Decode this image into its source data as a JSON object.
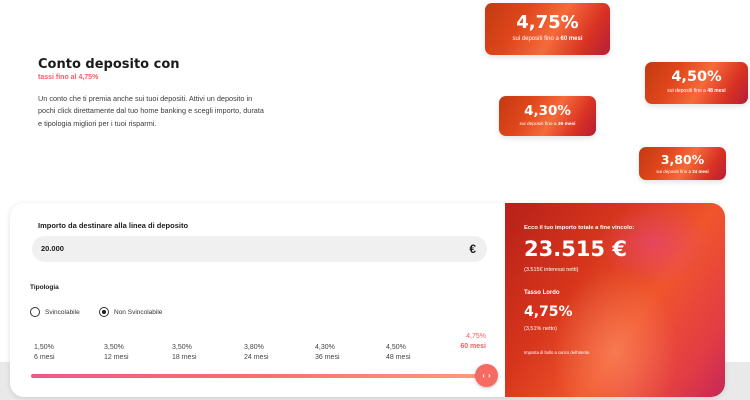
{
  "hero": {
    "title": "Conto deposito con",
    "subtitle": "tassi fino al 4,75%",
    "description": "Un conto che ti premia anche sui tuoi depositi. Attivi un deposito in pochi click direttamente dal tuo home banking e scegli importo, durata e tipologia migliori per i tuoi risparmi."
  },
  "badges": [
    {
      "rate": "4,75%",
      "caption_prefix": "sui depositi fino a",
      "caption_term": "60 mesi"
    },
    {
      "rate": "4,50%",
      "caption_prefix": "sui depositi fino a",
      "caption_term": "48 mesi"
    },
    {
      "rate": "4,30%",
      "caption_prefix": "sui depositi fino a",
      "caption_term": "36 mesi"
    },
    {
      "rate": "3,80%",
      "caption_prefix": "sui depositi fino a",
      "caption_term": "24 mesi"
    }
  ],
  "calculator": {
    "amount_label": "Importo da destinare alla linea di deposito",
    "amount_value": "20.000",
    "currency_symbol": "€",
    "tipologia_label": "Tipologia",
    "options": [
      {
        "label": "Svincolabile",
        "selected": false
      },
      {
        "label": "Non Svincolabile",
        "selected": true
      }
    ],
    "steps": [
      {
        "rate": "1,50%",
        "term": "6 mesi"
      },
      {
        "rate": "3,50%",
        "term": "12 mesi"
      },
      {
        "rate": "3,50%",
        "term": "18 mesi"
      },
      {
        "rate": "3,80%",
        "term": "24 mesi"
      },
      {
        "rate": "4,30%",
        "term": "36 mesi"
      },
      {
        "rate": "4,50%",
        "term": "48 mesi"
      },
      {
        "rate": "4,75%",
        "term": "60 mesi"
      }
    ],
    "selected_step": 6,
    "slider_arrows": {
      "left": "‹",
      "right": "›"
    }
  },
  "result": {
    "label": "Ecco il tuo importo totale a fine vincolo:",
    "total": "23.515 €",
    "interest": "(3.515€ interessi netti)",
    "tasso_label": "Tasso Lordo",
    "tasso": "4,75%",
    "netto": "(3,51% netto)",
    "note": "Imposta di bollo a carico dell'utente."
  },
  "colors": {
    "accent": "#ff5a5f",
    "badge_red": "#d8361c",
    "field_bg": "#f0f0f0"
  }
}
